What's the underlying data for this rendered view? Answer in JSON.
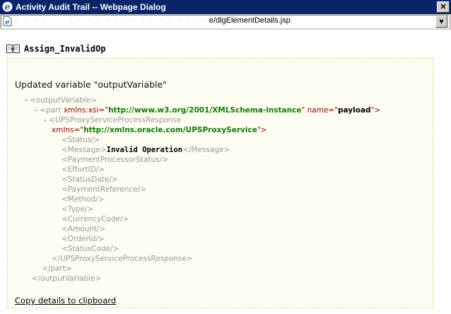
{
  "window": {
    "title": "Activity Audit Trail -- Webpage Dialog",
    "close_label": "✕"
  },
  "address": {
    "url_obscured": "· · · · · · · · · · · · · · · · · · · · · ·",
    "url_visible": "e/dlgElementDetails.jsp"
  },
  "activity": {
    "name": "Assign_InvalidOp",
    "description": "Updated variable \"outputVariable\"",
    "copy_link": "Copy details to clipboard"
  },
  "xml": {
    "minus": "-",
    "outputVariable_open": "<outputVariable>",
    "part_open": "<part ",
    "part_attr1_name": "xmlns:xsi=\"",
    "part_attr1_value": "http://www.w3.org/2001/XMLSchema-instance",
    "part_attr1_end": "\" ",
    "part_attr2_name": "name=\"",
    "part_attr2_value": "payload",
    "part_attr2_end": "\">",
    "response_open": "<UPSProxyServiceProcessResponse",
    "response_attr_name": "xmlns=\"",
    "response_attr_value": "http://xmlns.oracle.com/UPSProxyService",
    "response_attr_end": "\">",
    "status": "<Status/>",
    "message_open": "<Message>",
    "message_value": "Invalid Operation",
    "message_close": "</Message>",
    "payment_processor_status": "<PaymentProcessorStatus/>",
    "effort_id": "<EffortID/>",
    "status_date": "<StatusDate/>",
    "payment_reference": "<PaymentReference/>",
    "method": "<Method/>",
    "type": "<Type/>",
    "currency_code": "<CurrencyCode/>",
    "amount": "<Amount/>",
    "order_id": "<OrderId/>",
    "status_code": "<StatusCode/>",
    "response_close": "</UPSProxyServiceProcessResponse>",
    "part_close": "</part>",
    "outputVariable_close": "</outputVariable>"
  },
  "colors": {
    "title_bar": "#0a246a",
    "panel_background": "#fdfdf1",
    "panel_border": "#d6dc9a",
    "xml_tag": "#9a9a9a",
    "xml_attr": "#990000",
    "xml_ns_value": "#0b7d0b",
    "collapse_minus": "#ee0000"
  }
}
